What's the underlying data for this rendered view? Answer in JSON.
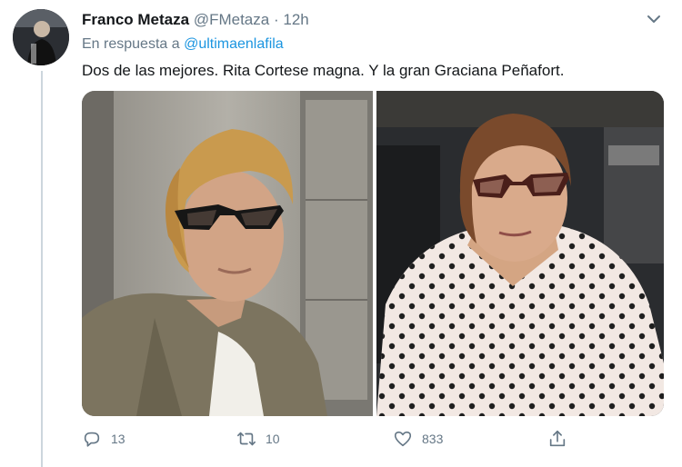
{
  "tweet": {
    "author_name": "Franco Metaza",
    "author_handle": "@FMetaza",
    "separator": "·",
    "time": "12h",
    "reply_prefix": "En respuesta a",
    "reply_to": "@ultimaenlafila",
    "text": "Dos de las mejores. Rita Cortese magna. Y la gran Graciana Peñafort."
  },
  "actions": {
    "replies": "13",
    "retweets": "10",
    "likes": "833"
  },
  "colors": {
    "link": "#1b95e0",
    "muted": "#657786",
    "text": "#14171a"
  },
  "icons": [
    "chevron-down-icon",
    "reply-icon",
    "retweet-icon",
    "like-icon",
    "share-icon"
  ]
}
